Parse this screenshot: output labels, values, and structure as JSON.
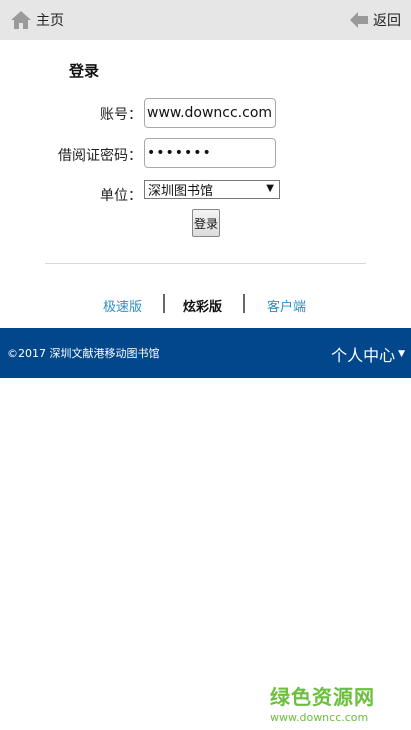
{
  "topbar": {
    "home_label": "主页",
    "back_label": "返回"
  },
  "login": {
    "title": "登录",
    "account_label": "账号：",
    "account_value": "www.downcc.com",
    "card_password_label": "借阅证密码：",
    "card_password_value": "•••••••",
    "unit_label": "单位：",
    "unit_selected": "深圳图书馆",
    "submit_label": "登录"
  },
  "versions": {
    "fast": "极速版",
    "color": "炫彩版",
    "client": "客户端"
  },
  "footer": {
    "copyright": "©2017 深圳文献港移动图书馆",
    "user_center": "个人中心"
  },
  "watermark": {
    "main": "绿色资源网",
    "sub": "www.downcc.com"
  },
  "colors": {
    "footer_bg": "#02478c",
    "link": "#2a8fc8",
    "topbar_bg": "#e6e6e6"
  }
}
